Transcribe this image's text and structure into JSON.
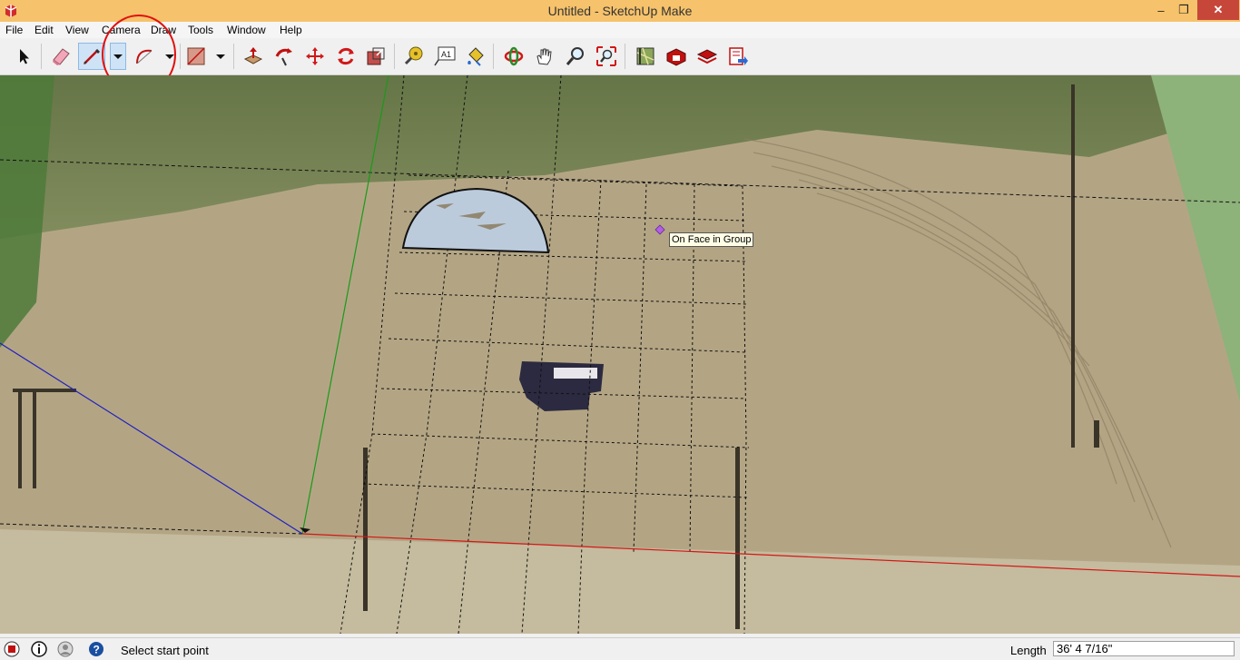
{
  "window": {
    "title": "Untitled - SketchUp Make",
    "minimize_glyph": "–",
    "restore_glyph": "❐",
    "close_glyph": "✕"
  },
  "menubar": {
    "items": [
      {
        "label": "File"
      },
      {
        "label": "Edit"
      },
      {
        "label": "View"
      },
      {
        "label": "Camera"
      },
      {
        "label": "Draw"
      },
      {
        "label": "Tools"
      },
      {
        "label": "Window"
      },
      {
        "label": "Help"
      }
    ]
  },
  "toolbar": {
    "tools": [
      {
        "icon": "select-arrow-icon"
      },
      {
        "icon": "eraser-icon"
      },
      {
        "icon": "pencil-line-icon",
        "active": true
      },
      {
        "icon": "arc-icon"
      },
      {
        "icon": "rectangle-icon"
      },
      {
        "icon": "push-pull-icon"
      },
      {
        "icon": "follow-me-icon"
      },
      {
        "icon": "move-icon"
      },
      {
        "icon": "rotate-icon"
      },
      {
        "icon": "scale-icon"
      },
      {
        "icon": "tape-measure-icon"
      },
      {
        "icon": "text-icon"
      },
      {
        "icon": "paint-bucket-icon"
      },
      {
        "icon": "orbit-icon"
      },
      {
        "icon": "pan-icon"
      },
      {
        "icon": "zoom-icon"
      },
      {
        "icon": "zoom-extents-icon"
      },
      {
        "icon": "add-location-icon"
      },
      {
        "icon": "warehouse-icon"
      },
      {
        "icon": "extension-warehouse-icon"
      },
      {
        "icon": "send-to-layout-icon"
      }
    ],
    "text_tool_label": "A1"
  },
  "viewport": {
    "tooltip": "On Face in Group"
  },
  "statusbar": {
    "message": "Select start point",
    "length_label": "Length",
    "length_value": "36' 4 7/16\""
  },
  "colors": {
    "titlebar": "#f6c26b",
    "ground": "#b3a584",
    "red_axis": "#d21818",
    "green_axis": "#1a9a1a",
    "blue_axis": "#2020c0",
    "semicircle_fill": "#bccbdc",
    "highlight": "#e01010"
  }
}
